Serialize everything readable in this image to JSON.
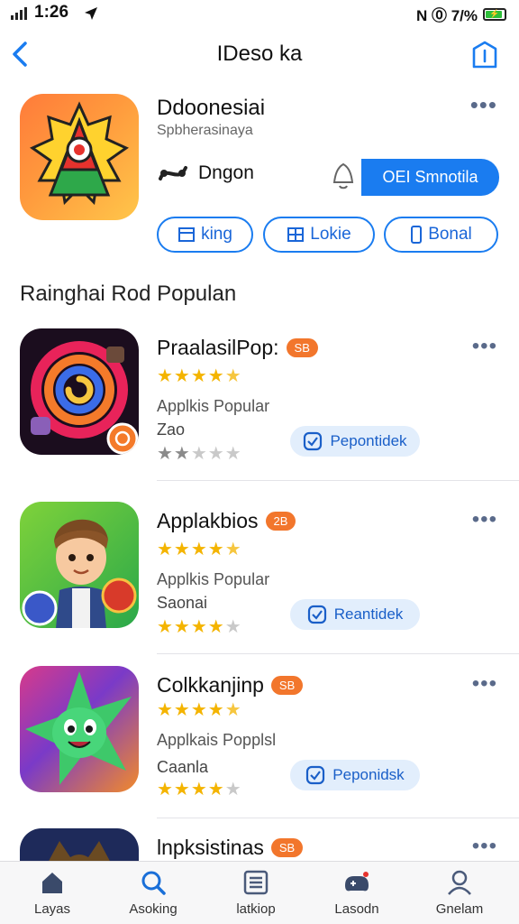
{
  "status": {
    "time": "1:26",
    "right_text": "N ⓪ 7/%"
  },
  "nav": {
    "title": "IDeso ka"
  },
  "hero": {
    "name": "Ddoonesiai",
    "subtitle": "Spbherasinaya",
    "developer": "Dngon",
    "get_label": "OEI Smnotila",
    "pills": [
      "king",
      "Lokie",
      "Bonal"
    ]
  },
  "section": {
    "title": "Rainghai Rod Populan"
  },
  "apps": [
    {
      "name": "PraalasilPop:",
      "badge": "SB",
      "rating": 4.5,
      "desc": "Applkis Popular",
      "sub": "Zao",
      "sub_rating": 2,
      "button": "Pepontidek"
    },
    {
      "name": "Applakbios",
      "badge": "2B",
      "rating": 4.5,
      "desc": "Applkis Popular",
      "sub": "Saonai",
      "sub_rating": 4,
      "button": "Reantidek"
    },
    {
      "name": "Colkkanjinp",
      "badge": "SB",
      "rating": 4.5,
      "desc": "Applkais Popplsl",
      "sub": "Caanla",
      "sub_rating": 4,
      "button": "Peponidsk"
    },
    {
      "name": "lnpksistinas",
      "badge": "SB"
    }
  ],
  "tabs": [
    {
      "label": "Layas",
      "icon": "home-icon"
    },
    {
      "label": "Asoking",
      "icon": "search-icon"
    },
    {
      "label": "latkiop",
      "icon": "list-icon"
    },
    {
      "label": "Lasodn",
      "icon": "game-controller-icon"
    },
    {
      "label": "Gnelam",
      "icon": "profile-icon"
    }
  ],
  "colors": {
    "accent": "#1a7cf0",
    "badge": "#f2762c",
    "star": "#f4b400"
  }
}
